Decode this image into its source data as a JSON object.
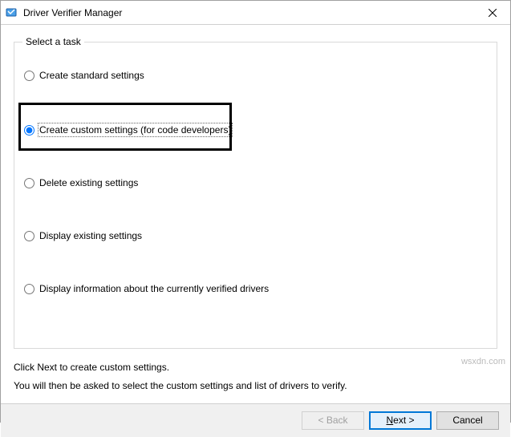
{
  "window": {
    "title": "Driver Verifier Manager"
  },
  "group": {
    "legend": "Select a task"
  },
  "options": {
    "createStandard": "Create standard settings",
    "createCustom": "Create custom settings (for code developers)",
    "deleteExisting": "Delete existing settings",
    "displayExisting": "Display existing settings",
    "displayInfo": "Display information about the currently verified drivers"
  },
  "info": {
    "line1": "Click Next to create custom settings.",
    "line2": "You will then be asked to select the custom settings and list of drivers to verify."
  },
  "buttons": {
    "back": "< Back",
    "nextPrefix": "N",
    "nextRest": "ext >",
    "cancel": "Cancel"
  },
  "watermark": "wsxdn.com"
}
